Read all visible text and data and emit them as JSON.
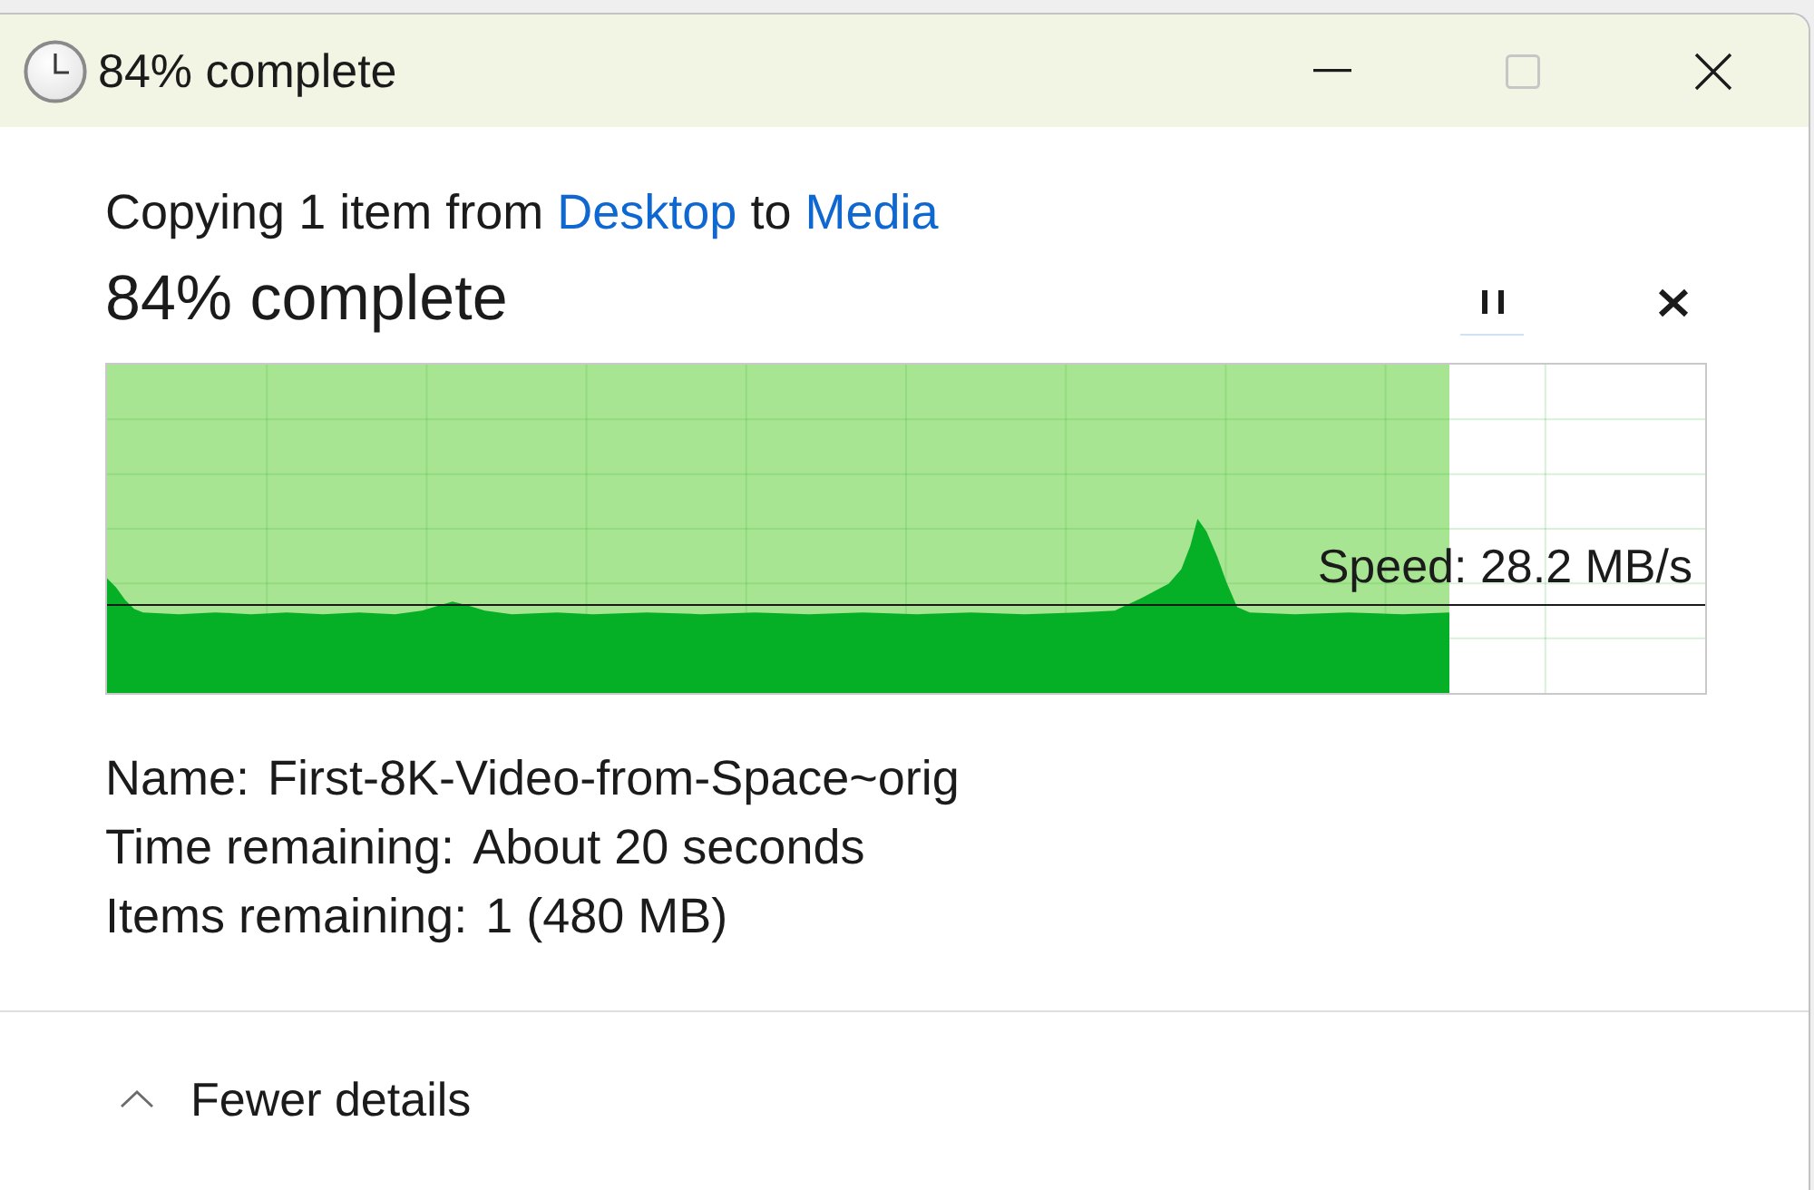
{
  "window": {
    "title": "84% complete",
    "maximize_disabled": true
  },
  "summary": [
    {
      "kind": "text",
      "text": "Copying 1 item from"
    },
    {
      "kind": "link",
      "text": "Desktop"
    },
    {
      "kind": "text",
      "text": "to"
    },
    {
      "kind": "link",
      "text": "Media"
    }
  ],
  "progress": {
    "heading": "84% complete"
  },
  "speed_graph": {
    "level": 0.84,
    "speed_label": "Speed: 28.2 MB/s"
  },
  "details": [
    {
      "label": "Name:",
      "value": "First-8K-Video-from-Space~orig"
    },
    {
      "label": "Time remaining:",
      "value": "About 20 seconds"
    },
    {
      "label": "Items remaining:",
      "value": "1 (480 MB)"
    }
  ],
  "footer": {
    "toggle_label": "Fewer details",
    "expanded": true
  }
}
